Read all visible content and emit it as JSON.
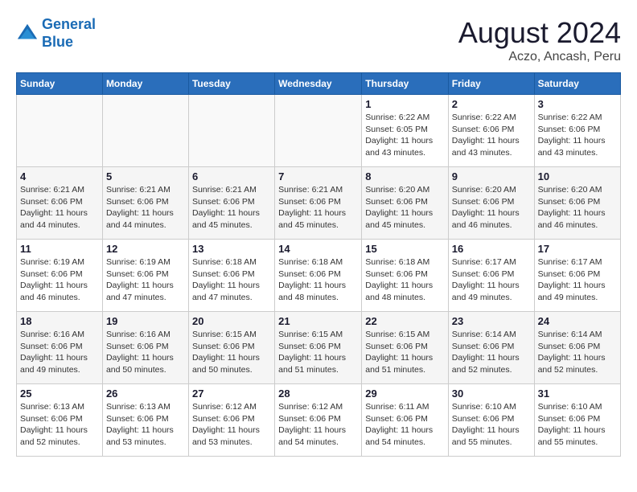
{
  "logo": {
    "line1": "General",
    "line2": "Blue"
  },
  "title": "August 2024",
  "location": "Aczo, Ancash, Peru",
  "days_of_week": [
    "Sunday",
    "Monday",
    "Tuesday",
    "Wednesday",
    "Thursday",
    "Friday",
    "Saturday"
  ],
  "weeks": [
    [
      {
        "day": "",
        "info": ""
      },
      {
        "day": "",
        "info": ""
      },
      {
        "day": "",
        "info": ""
      },
      {
        "day": "",
        "info": ""
      },
      {
        "day": "1",
        "info": "Sunrise: 6:22 AM\nSunset: 6:05 PM\nDaylight: 11 hours\nand 43 minutes."
      },
      {
        "day": "2",
        "info": "Sunrise: 6:22 AM\nSunset: 6:06 PM\nDaylight: 11 hours\nand 43 minutes."
      },
      {
        "day": "3",
        "info": "Sunrise: 6:22 AM\nSunset: 6:06 PM\nDaylight: 11 hours\nand 43 minutes."
      }
    ],
    [
      {
        "day": "4",
        "info": "Sunrise: 6:21 AM\nSunset: 6:06 PM\nDaylight: 11 hours\nand 44 minutes."
      },
      {
        "day": "5",
        "info": "Sunrise: 6:21 AM\nSunset: 6:06 PM\nDaylight: 11 hours\nand 44 minutes."
      },
      {
        "day": "6",
        "info": "Sunrise: 6:21 AM\nSunset: 6:06 PM\nDaylight: 11 hours\nand 45 minutes."
      },
      {
        "day": "7",
        "info": "Sunrise: 6:21 AM\nSunset: 6:06 PM\nDaylight: 11 hours\nand 45 minutes."
      },
      {
        "day": "8",
        "info": "Sunrise: 6:20 AM\nSunset: 6:06 PM\nDaylight: 11 hours\nand 45 minutes."
      },
      {
        "day": "9",
        "info": "Sunrise: 6:20 AM\nSunset: 6:06 PM\nDaylight: 11 hours\nand 46 minutes."
      },
      {
        "day": "10",
        "info": "Sunrise: 6:20 AM\nSunset: 6:06 PM\nDaylight: 11 hours\nand 46 minutes."
      }
    ],
    [
      {
        "day": "11",
        "info": "Sunrise: 6:19 AM\nSunset: 6:06 PM\nDaylight: 11 hours\nand 46 minutes."
      },
      {
        "day": "12",
        "info": "Sunrise: 6:19 AM\nSunset: 6:06 PM\nDaylight: 11 hours\nand 47 minutes."
      },
      {
        "day": "13",
        "info": "Sunrise: 6:18 AM\nSunset: 6:06 PM\nDaylight: 11 hours\nand 47 minutes."
      },
      {
        "day": "14",
        "info": "Sunrise: 6:18 AM\nSunset: 6:06 PM\nDaylight: 11 hours\nand 48 minutes."
      },
      {
        "day": "15",
        "info": "Sunrise: 6:18 AM\nSunset: 6:06 PM\nDaylight: 11 hours\nand 48 minutes."
      },
      {
        "day": "16",
        "info": "Sunrise: 6:17 AM\nSunset: 6:06 PM\nDaylight: 11 hours\nand 49 minutes."
      },
      {
        "day": "17",
        "info": "Sunrise: 6:17 AM\nSunset: 6:06 PM\nDaylight: 11 hours\nand 49 minutes."
      }
    ],
    [
      {
        "day": "18",
        "info": "Sunrise: 6:16 AM\nSunset: 6:06 PM\nDaylight: 11 hours\nand 49 minutes."
      },
      {
        "day": "19",
        "info": "Sunrise: 6:16 AM\nSunset: 6:06 PM\nDaylight: 11 hours\nand 50 minutes."
      },
      {
        "day": "20",
        "info": "Sunrise: 6:15 AM\nSunset: 6:06 PM\nDaylight: 11 hours\nand 50 minutes."
      },
      {
        "day": "21",
        "info": "Sunrise: 6:15 AM\nSunset: 6:06 PM\nDaylight: 11 hours\nand 51 minutes."
      },
      {
        "day": "22",
        "info": "Sunrise: 6:15 AM\nSunset: 6:06 PM\nDaylight: 11 hours\nand 51 minutes."
      },
      {
        "day": "23",
        "info": "Sunrise: 6:14 AM\nSunset: 6:06 PM\nDaylight: 11 hours\nand 52 minutes."
      },
      {
        "day": "24",
        "info": "Sunrise: 6:14 AM\nSunset: 6:06 PM\nDaylight: 11 hours\nand 52 minutes."
      }
    ],
    [
      {
        "day": "25",
        "info": "Sunrise: 6:13 AM\nSunset: 6:06 PM\nDaylight: 11 hours\nand 52 minutes."
      },
      {
        "day": "26",
        "info": "Sunrise: 6:13 AM\nSunset: 6:06 PM\nDaylight: 11 hours\nand 53 minutes."
      },
      {
        "day": "27",
        "info": "Sunrise: 6:12 AM\nSunset: 6:06 PM\nDaylight: 11 hours\nand 53 minutes."
      },
      {
        "day": "28",
        "info": "Sunrise: 6:12 AM\nSunset: 6:06 PM\nDaylight: 11 hours\nand 54 minutes."
      },
      {
        "day": "29",
        "info": "Sunrise: 6:11 AM\nSunset: 6:06 PM\nDaylight: 11 hours\nand 54 minutes."
      },
      {
        "day": "30",
        "info": "Sunrise: 6:10 AM\nSunset: 6:06 PM\nDaylight: 11 hours\nand 55 minutes."
      },
      {
        "day": "31",
        "info": "Sunrise: 6:10 AM\nSunset: 6:06 PM\nDaylight: 11 hours\nand 55 minutes."
      }
    ]
  ]
}
